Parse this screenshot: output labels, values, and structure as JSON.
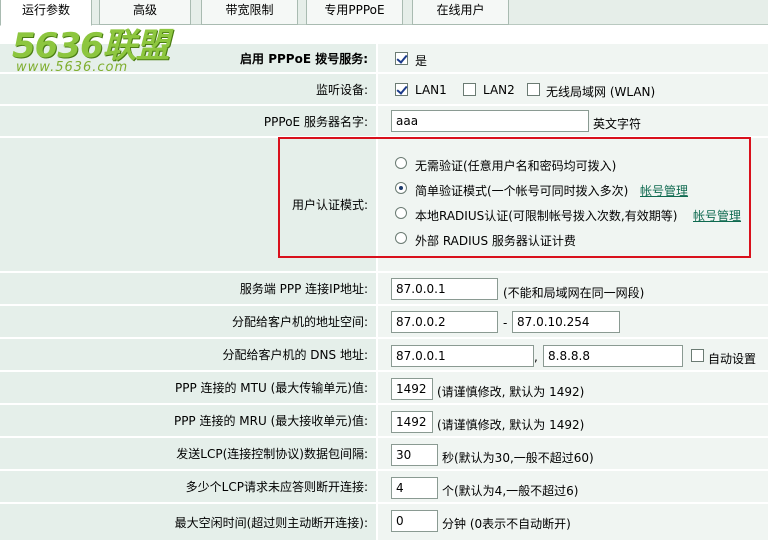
{
  "tabs": [
    {
      "label": "运行参数"
    },
    {
      "label": "高级"
    },
    {
      "label": "带宽限制"
    },
    {
      "label": "专用PPPoE"
    },
    {
      "label": "在线用户"
    }
  ],
  "logo": {
    "main": "5636联盟",
    "sub": "www.5636.com"
  },
  "form": {
    "enable": {
      "label": "启用 PPPoE 拨号服务:",
      "option": "是"
    },
    "listen": {
      "label": "监听设备:",
      "lan1": "LAN1",
      "lan2": "LAN2",
      "wlan": "无线局域网 (WLAN)"
    },
    "server_name": {
      "label": "PPPoE 服务器名字:",
      "value": "aaa",
      "hint": "英文字符"
    },
    "auth": {
      "label": "用户认证模式:",
      "options": [
        {
          "label": "无需验证(任意用户名和密码均可拨入)"
        },
        {
          "label": "简单验证模式(一个帐号可同时拨入多次)",
          "link": "帐号管理"
        },
        {
          "label": "本地RADIUS认证(可限制帐号拨入次数,有效期等)",
          "link": "帐号管理"
        },
        {
          "label": "外部 RADIUS 服务器认证计费"
        }
      ]
    },
    "server_ip": {
      "label": "服务端 PPP 连接IP地址:",
      "value": "87.0.0.1",
      "hint": "(不能和局域网在同一网段)"
    },
    "client_range": {
      "label": "分配给客户机的地址空间:",
      "start": "87.0.0.2",
      "sep": "-",
      "end": "87.0.10.254"
    },
    "client_dns": {
      "label": "分配给客户机的 DNS 地址:",
      "primary": "87.0.0.1",
      "sep": ",",
      "secondary": "8.8.8.8",
      "auto": "自动设置"
    },
    "mtu": {
      "label": "PPP 连接的 MTU (最大传输单元)值:",
      "value": "1492",
      "hint": "(请谨慎修改, 默认为  1492)"
    },
    "mru": {
      "label": "PPP 连接的 MRU (最大接收单元)值:",
      "value": "1492",
      "hint": "(请谨慎修改, 默认为  1492)"
    },
    "lcp_interval": {
      "label": "发送LCP(连接控制协议)数据包间隔:",
      "value": "30",
      "hint": "秒(默认为30,一般不超过60)"
    },
    "lcp_fail": {
      "label": "多少个LCP请求未应答则断开连接:",
      "value": "4",
      "hint": "个(默认为4,一般不超过6)"
    },
    "idle": {
      "label": "最大空闲时间(超过则主动断开连接):",
      "value": "0",
      "hint": "分钟  (0表示不自动断开)"
    }
  },
  "colors": {
    "label_bg": "#e5efea",
    "value_bg": "#f0f5f2",
    "highlight": "#d9101c",
    "link": "#0f6a50",
    "logo": "#8dc63f"
  }
}
